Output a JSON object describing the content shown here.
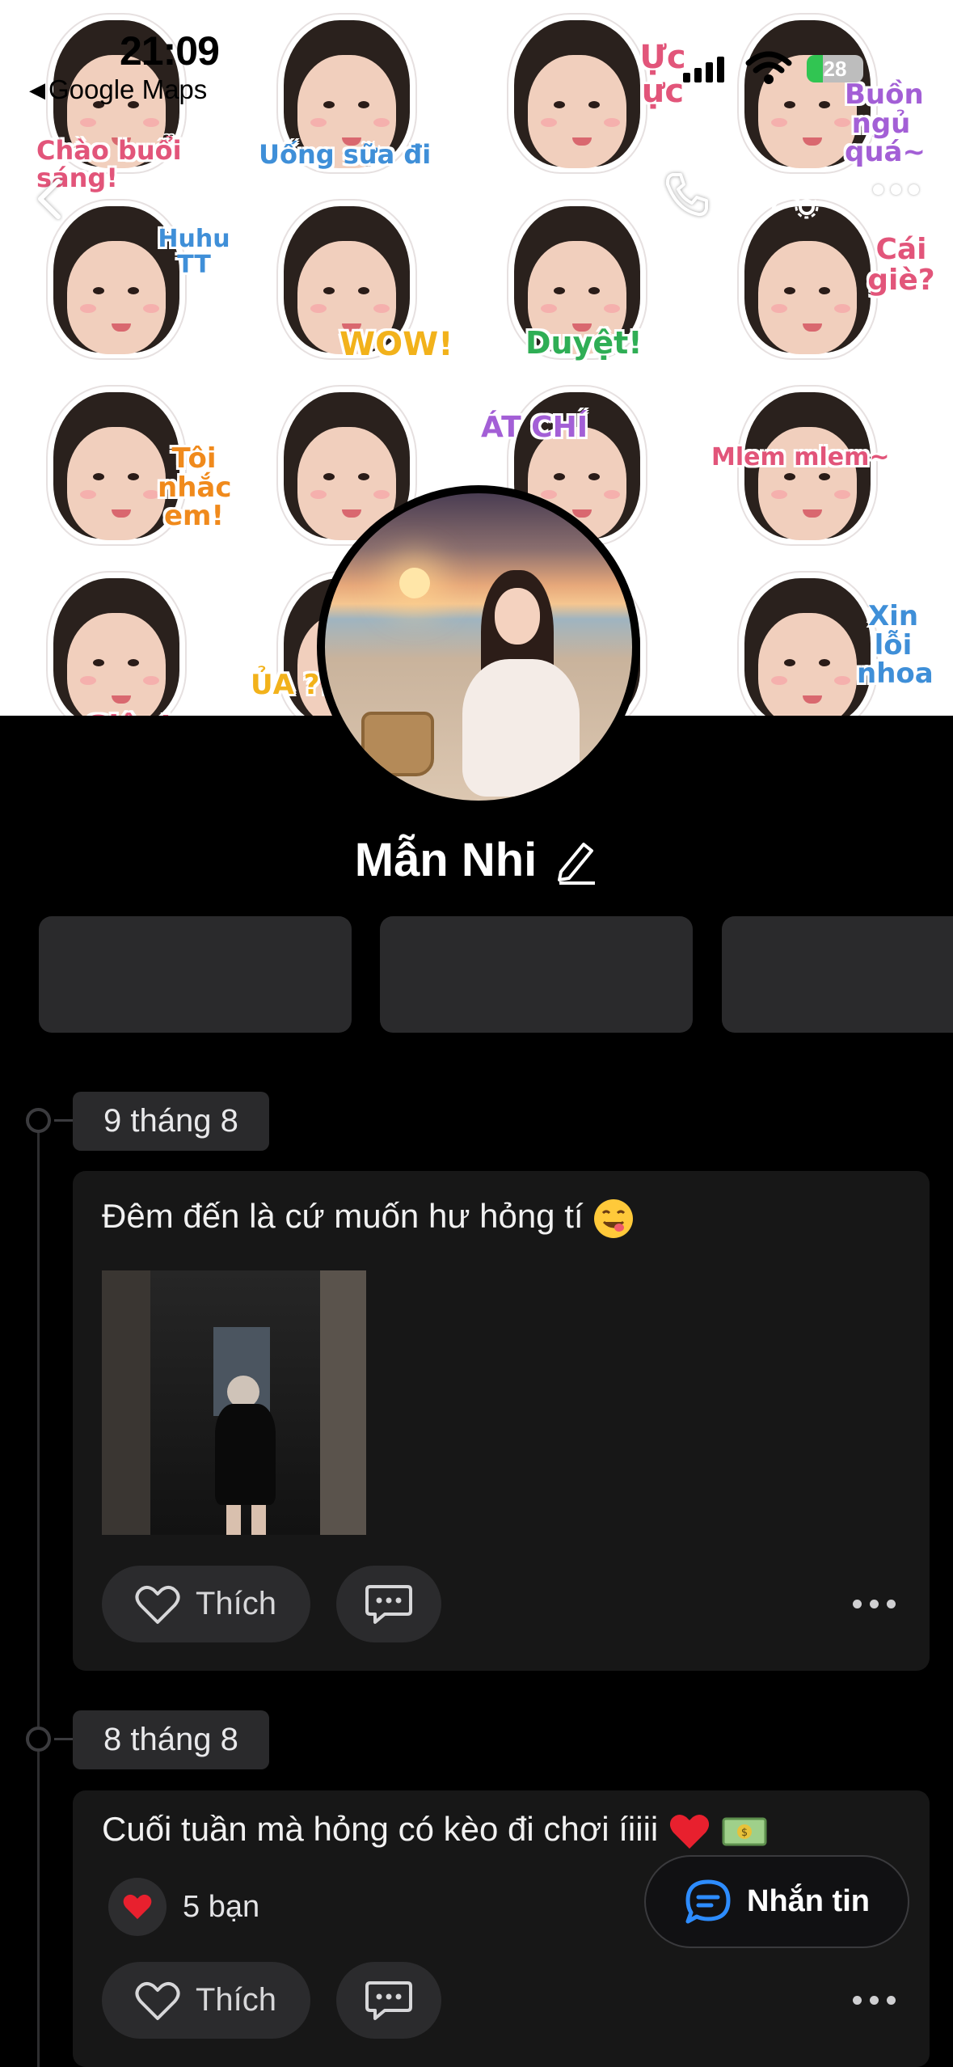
{
  "status_bar": {
    "time": "21:09",
    "back_app": "Google Maps",
    "battery": "28"
  },
  "cover": {
    "stickers": [
      {
        "text": "Chào buổi sáng!",
        "color": "#e2557a"
      },
      {
        "text": "Uống sữa đi",
        "color": "#3f8fd8"
      },
      {
        "text": "Ực ực",
        "color": "#e2557a"
      },
      {
        "text": "Buồn ngủ quá~",
        "color": "#a35fd6"
      },
      {
        "text": "Huhu TT",
        "color": "#3f8fd8"
      },
      {
        "text": "WOW!",
        "color": "#f2b21b"
      },
      {
        "text": "Duyệt!",
        "color": "#2fae55"
      },
      {
        "text": "Cái giè?",
        "color": "#e2557a"
      },
      {
        "text": "Tôi nhắc em!",
        "color": "#f08a1c"
      },
      {
        "text": "",
        "color": "#e2557a"
      },
      {
        "text": "ÁT CHÍ",
        "color": "#a35fd6"
      },
      {
        "text": "Mlem mlem~",
        "color": "#e2557a"
      },
      {
        "text": "Giận!",
        "color": "#e2557a"
      },
      {
        "text": "ỦA ???",
        "color": "#f2b21b"
      },
      {
        "text": "",
        "color": "#3f8fd8"
      },
      {
        "text": "Xin lỗi nhoa",
        "color": "#3f8fd8"
      }
    ]
  },
  "profile": {
    "name": "Mẫn Nhi"
  },
  "posts": [
    {
      "date": "9 tháng 8",
      "text": "Đêm đến là cứ muốn hư hỏng tí",
      "like_label": "Thích"
    },
    {
      "date": "8 tháng 8",
      "text": "Cuối tuần mà hỏng có kèo đi chơi íiiii",
      "reaction_count": "5 bạn",
      "like_label": "Thích"
    }
  ],
  "message_button": {
    "label": "Nhắn tin"
  },
  "colors": {
    "background": "#000000",
    "card": "#171717",
    "chip": "#2a2a2c",
    "accent": "#2d8cff",
    "battery": "#31c552"
  }
}
